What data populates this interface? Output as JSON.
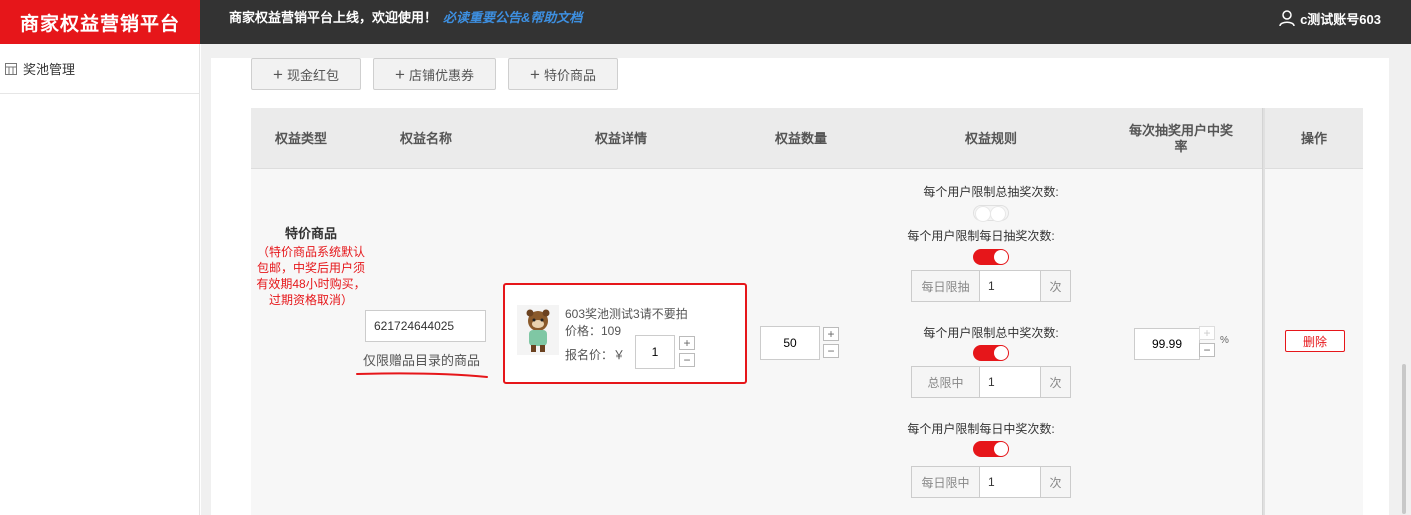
{
  "header": {
    "brand": "商家权益营销平台",
    "notice_text": "商家权益营销平台上线，欢迎使用！",
    "notice_link": "必读重要公告&帮助文档",
    "account": "c测试账号603"
  },
  "sidebar": {
    "items": [
      {
        "label": "奖池管理"
      }
    ]
  },
  "actions": {
    "add_cash": "现金红包",
    "add_coupon": "店铺优惠券",
    "add_special": "特价商品"
  },
  "table": {
    "headers": {
      "type": "权益类型",
      "name": "权益名称",
      "detail": "权益详情",
      "quantity": "权益数量",
      "rules": "权益规则",
      "rate_line1": "每次抽奖用户中奖",
      "rate_line2": "率",
      "ops": "操作"
    },
    "row": {
      "type_title": "特价商品",
      "type_note": "（特价商品系统默认包邮，中奖后用户须有效期48小时购买，过期资格取消）",
      "name_value": "621724644025",
      "name_hint": "仅限赠品目录的商品",
      "detail": {
        "product_name": "603奖池测试3请不要拍",
        "price_text": "价格：109",
        "signup_label": "报名价：￥",
        "signup_value": "1"
      },
      "quantity_value": "50",
      "rules": [
        {
          "label": "每个用户限制总抽奖次数:",
          "enabled": false
        },
        {
          "label": "每个用户限制每日抽奖次数:",
          "enabled": true,
          "prefix": "每日限抽",
          "value": "1",
          "suffix": "次"
        },
        {
          "label": "每个用户限制总中奖次数:",
          "enabled": true,
          "prefix": "总限中",
          "value": "1",
          "suffix": "次"
        },
        {
          "label": "每个用户限制每日中奖次数:",
          "enabled": true,
          "prefix": "每日限中",
          "value": "1",
          "suffix": "次"
        }
      ],
      "rate_value": "99.99",
      "rate_unit": "%",
      "delete_label": "删除"
    }
  },
  "colors": {
    "brand_red": "#e6161a",
    "topbar": "#333333",
    "link_blue": "#3d8fe0"
  }
}
